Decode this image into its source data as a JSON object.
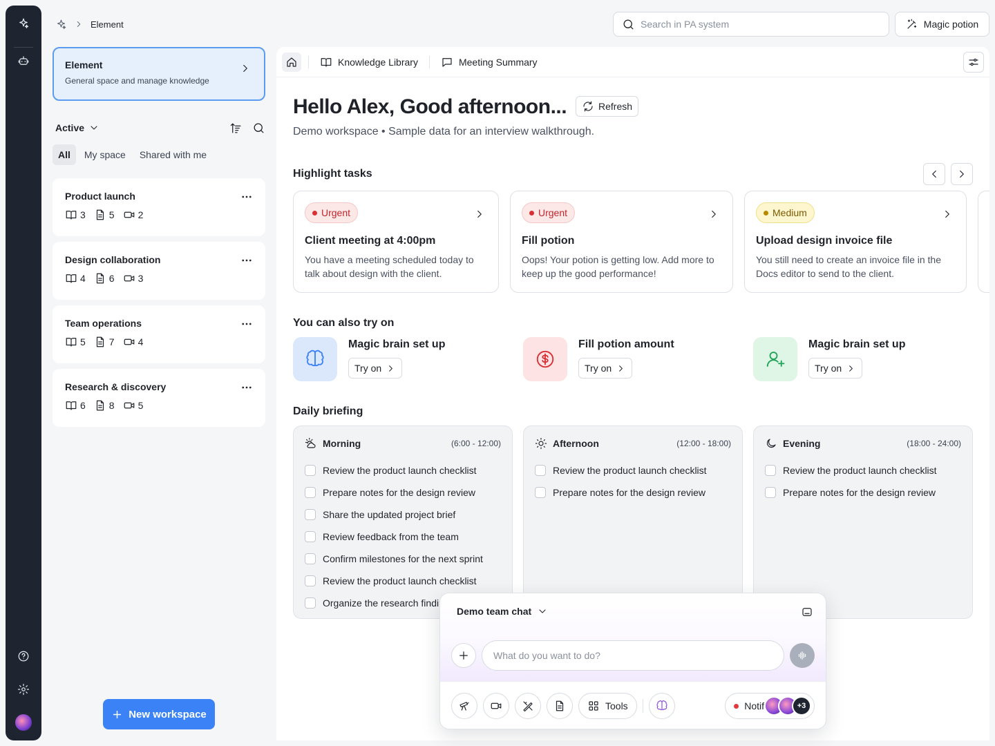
{
  "breadcrumb": {
    "current": "Element"
  },
  "search": {
    "placeholder": "Search in PA system"
  },
  "top_actions": {
    "magic_label": "Magic potion"
  },
  "sidebar": {
    "element_card": {
      "title": "Element",
      "subtitle": "General space and manage knowledge"
    },
    "filter_label": "Active",
    "tabs": [
      "All",
      "My space",
      "Shared with me"
    ],
    "selected_tab": "All",
    "workspaces": [
      {
        "name": "Product launch",
        "docs": "3",
        "files": "5",
        "videos": "2"
      },
      {
        "name": "Design collaboration",
        "docs": "4",
        "files": "6",
        "videos": "3"
      },
      {
        "name": "Team operations",
        "docs": "5",
        "files": "7",
        "videos": "4"
      },
      {
        "name": "Research & discovery",
        "docs": "6",
        "files": "8",
        "videos": "5"
      }
    ],
    "new_workspace_label": "New workspace"
  },
  "main_tabs": {
    "knowledge": "Knowledge Library",
    "meeting": "Meeting Summary"
  },
  "greeting": {
    "title": "Hello Alex, Good afternoon...",
    "refresh_label": "Refresh",
    "subtitle": "Demo workspace • Sample data for an interview walkthrough."
  },
  "highlight": {
    "title": "Highlight tasks",
    "tasks": [
      {
        "priority": "Urgent",
        "title": "Client meeting at 4:00pm",
        "desc": "You have a meeting scheduled today to talk about design with the client."
      },
      {
        "priority": "Urgent",
        "title": "Fill potion",
        "desc": "Oops! Your potion is getting low. Add more to keep up the good performance!"
      },
      {
        "priority": "Medium",
        "title": "Upload design invoice file",
        "desc": "You still need to create an invoice file in the Docs editor to send to the client."
      }
    ]
  },
  "try_on": {
    "title": "You can also try on",
    "button_label": "Try on",
    "items": [
      {
        "title": "Magic brain set up",
        "icon": "brain-icon"
      },
      {
        "title": "Fill potion amount",
        "icon": "dollar-icon"
      },
      {
        "title": "Magic brain set up",
        "icon": "user-plus-icon"
      }
    ]
  },
  "briefing": {
    "title": "Daily briefing",
    "periods": [
      {
        "name": "Morning",
        "time": "(6:00 - 12:00)",
        "items": [
          "Review the product launch checklist",
          "Prepare notes for the design review",
          "Share the updated project brief",
          "Review feedback from the team",
          "Confirm milestones for the next sprint",
          "Review the product launch checklist",
          "Organize the research findings"
        ]
      },
      {
        "name": "Afternoon",
        "time": "(12:00 - 18:00)",
        "items": [
          "Review the product launch checklist",
          "Prepare notes for the design review"
        ]
      },
      {
        "name": "Evening",
        "time": "(18:00 - 24:00)",
        "items": [
          "Review the product launch checklist",
          "Prepare notes for the design review"
        ]
      }
    ]
  },
  "chat": {
    "title": "Demo team chat",
    "input_placeholder": "What do you want to do?",
    "tools_label": "Tools",
    "notif_label": "Notif",
    "extra_members": "+3"
  },
  "colors": {
    "accent": "#3b82f6",
    "urgent": "#d93036",
    "medium": "#b78900",
    "rail": "#1e2530"
  }
}
